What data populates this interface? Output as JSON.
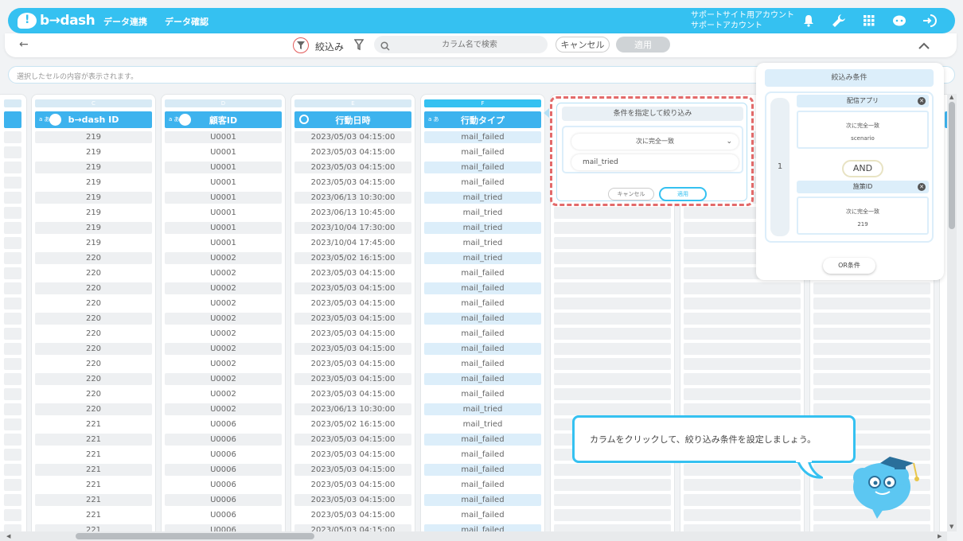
{
  "header": {
    "logo_text": "b→dash",
    "nav": [
      "データ連携",
      "データ確認"
    ],
    "account_line1": "サポートサイト用アカウント",
    "account_line2": "サポートアカウント",
    "icons": [
      "bell-icon",
      "wrench-icon",
      "grid-icon",
      "chat-icon",
      "logout-icon"
    ],
    "color": "#35c1f1"
  },
  "filterbar": {
    "back": "←",
    "filter_label": "絞込み",
    "search_placeholder": "カラム名で検索",
    "cancel": "キャンセル",
    "apply": "適用",
    "collapse": "⌃"
  },
  "cellbar": {
    "placeholder": "選択したセルの内容が表示されます。"
  },
  "columns": [
    {
      "letter": "C",
      "header": "b→dash ID",
      "badge": "a あ",
      "icon": "people-icon",
      "active": false,
      "cells": [
        "219",
        "219",
        "219",
        "219",
        "219",
        "219",
        "219",
        "219",
        "220",
        "220",
        "220",
        "220",
        "220",
        "220",
        "220",
        "220",
        "220",
        "220",
        "220",
        "221",
        "221",
        "221",
        "221",
        "221",
        "221",
        "221",
        "221"
      ]
    },
    {
      "letter": "D",
      "header": "顧客ID",
      "badge": "a あ",
      "icon": "people-icon",
      "active": false,
      "cells": [
        "U0001",
        "U0001",
        "U0001",
        "U0001",
        "U0001",
        "U0001",
        "U0001",
        "U0001",
        "U0002",
        "U0002",
        "U0002",
        "U0002",
        "U0002",
        "U0002",
        "U0002",
        "U0002",
        "U0002",
        "U0002",
        "U0002",
        "U0006",
        "U0006",
        "U0006",
        "U0006",
        "U0006",
        "U0006",
        "U0006",
        "U0006"
      ]
    },
    {
      "letter": "E",
      "header": "行動日時",
      "badge": "",
      "icon": "clock-icon",
      "active": false,
      "cells": [
        "2023/05/03 04:15:00",
        "2023/05/03 04:15:00",
        "2023/05/03 04:15:00",
        "2023/05/03 04:15:00",
        "2023/06/13 10:30:00",
        "2023/06/13 10:45:00",
        "2023/10/04 17:30:00",
        "2023/10/04 17:45:00",
        "2023/05/02 16:15:00",
        "2023/05/03 04:15:00",
        "2023/05/03 04:15:00",
        "2023/05/03 04:15:00",
        "2023/05/03 04:15:00",
        "2023/05/03 04:15:00",
        "2023/05/03 04:15:00",
        "2023/05/03 04:15:00",
        "2023/05/03 04:15:00",
        "2023/05/03 04:15:00",
        "2023/06/13 10:30:00",
        "2023/05/02 16:15:00",
        "2023/05/03 04:15:00",
        "2023/05/03 04:15:00",
        "2023/05/03 04:15:00",
        "2023/05/03 04:15:00",
        "2023/05/03 04:15:00",
        "2023/05/03 04:15:00",
        "2023/05/03 04:15:00"
      ]
    },
    {
      "letter": "F",
      "header": "行動タイプ",
      "badge": "a あ",
      "icon": "",
      "active": true,
      "cells": [
        "mail_failed",
        "mail_failed",
        "mail_failed",
        "mail_failed",
        "mail_tried",
        "mail_tried",
        "mail_tried",
        "mail_tried",
        "mail_tried",
        "mail_failed",
        "mail_failed",
        "mail_failed",
        "mail_failed",
        "mail_failed",
        "mail_failed",
        "mail_failed",
        "mail_failed",
        "mail_failed",
        "mail_tried",
        "mail_tried",
        "mail_failed",
        "mail_failed",
        "mail_failed",
        "mail_failed",
        "mail_failed",
        "mail_failed",
        "mail_failed"
      ]
    }
  ],
  "popup": {
    "title": "条件を指定して絞り込み",
    "operator": "次に完全一致",
    "value": "mail_tried",
    "cancel": "キャンセル",
    "apply": "適用"
  },
  "conditions": {
    "title": "絞込み条件",
    "group_number": "1",
    "items": [
      {
        "name": "配信アプリ",
        "operator": "次に完全一致",
        "value": "scenario"
      },
      {
        "name": "施策ID",
        "operator": "次に完全一致",
        "value": "219"
      }
    ],
    "and_label": "AND",
    "or_label": "OR条件"
  },
  "tip": {
    "text": "カラムをクリックして、絞り込み条件を設定しましょう。"
  }
}
